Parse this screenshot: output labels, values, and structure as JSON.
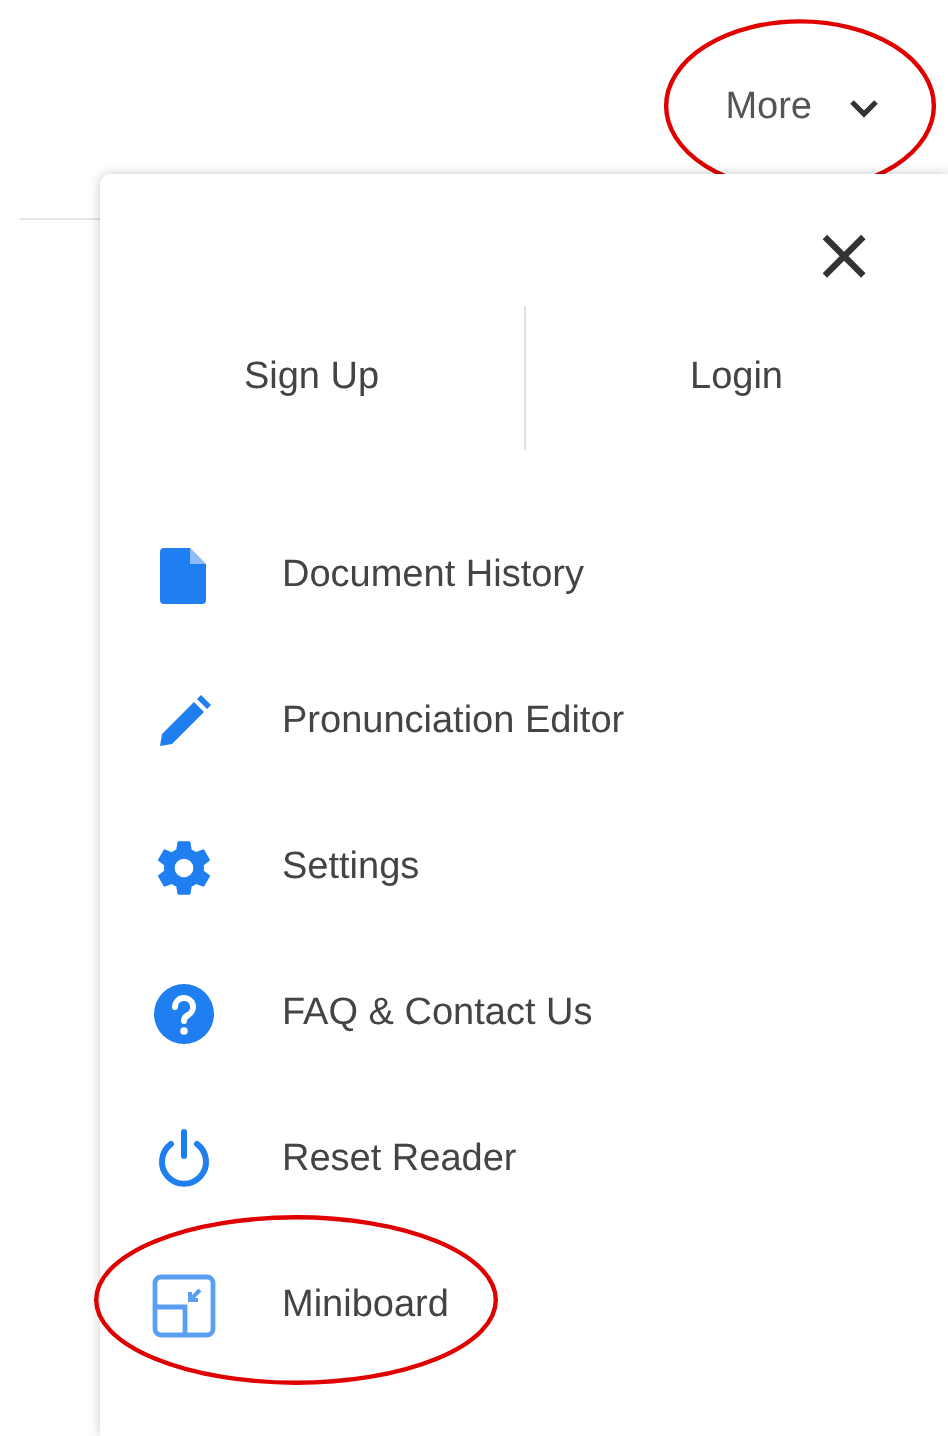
{
  "top_bar": {
    "more_button": {
      "label": "More",
      "circled": true
    }
  },
  "menu": {
    "close": "×",
    "auth_buttons": [
      {
        "label": "Sign Up"
      },
      {
        "label": "Login"
      }
    ],
    "items": [
      {
        "kind": "document",
        "label": "Document History",
        "circled": false
      },
      {
        "kind": "pencil",
        "label": "Pronunciation Editor",
        "circled": false
      },
      {
        "kind": "gear",
        "label": "Settings",
        "circled": false
      },
      {
        "kind": "help",
        "label": "FAQ & Contact Us",
        "circled": false
      },
      {
        "kind": "power",
        "label": "Reset Reader",
        "circled": false
      },
      {
        "kind": "miniboard",
        "label": "Miniboard",
        "circled": true
      }
    ]
  }
}
